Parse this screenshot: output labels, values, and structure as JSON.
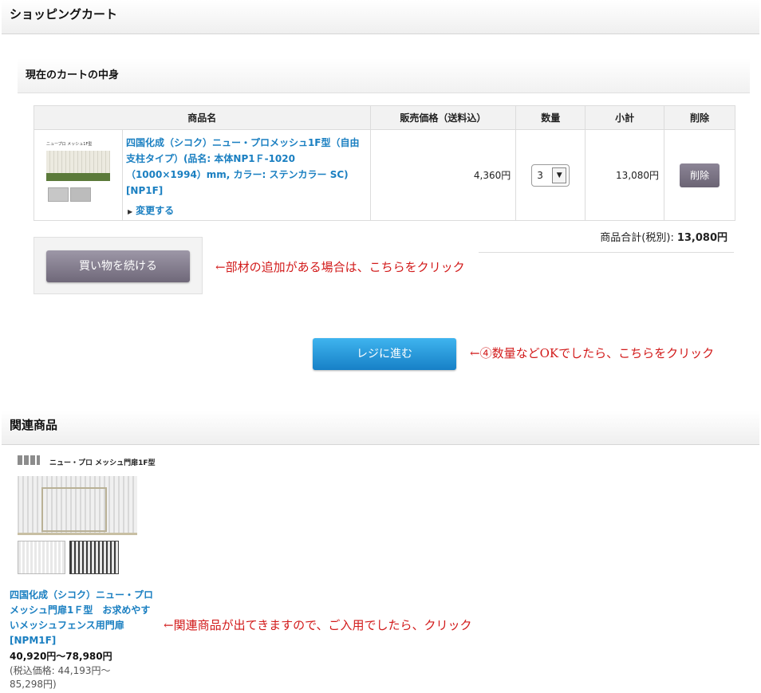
{
  "cart_section": {
    "title": "ショッピングカート"
  },
  "cart_contents": {
    "title": "現在のカートの中身"
  },
  "table": {
    "headers": {
      "product": "商品名",
      "price": "販売価格（送料込）",
      "qty": "数量",
      "subtotal": "小計",
      "delete": "削除"
    },
    "row": {
      "thumb_caption": "ニュープロ メッシュ1F型",
      "name": "四国化成（シコク）ニュー・プロメッシュ1F型（自由支柱タイプ）(品名: 本体NP1Ｆ-1020（1000×1994）mm, カラー: ステンカラー SC) [NP1F]",
      "change_link": "変更する",
      "price": "4,360円",
      "qty": "3",
      "subtotal": "13,080円",
      "delete_label": "削除"
    }
  },
  "total": {
    "label": "商品合計(税別):",
    "amount": "13,080円"
  },
  "continue_button": "買い物を続ける",
  "checkout_button": "レジに進む",
  "notes": {
    "continue": "←部材の追加がある場合は、こちらをクリック",
    "checkout": "←④数量などOKでしたら、こちらをクリック",
    "related": "←関連商品が出てきますので、ご入用でしたら、クリック"
  },
  "related_section": {
    "title": "関連商品"
  },
  "related_item": {
    "image_title": "ニュー・プロ メッシュ門扉1F型",
    "name": "四国化成（シコク）ニュー・プロメッシュ門扉1Ｆ型　お求めやすいメッシュフェンス用門扉　[NPM1F]",
    "price": "40,920円〜78,980円",
    "tax_price": "(税込価格: 44,193円〜85,298円)"
  }
}
